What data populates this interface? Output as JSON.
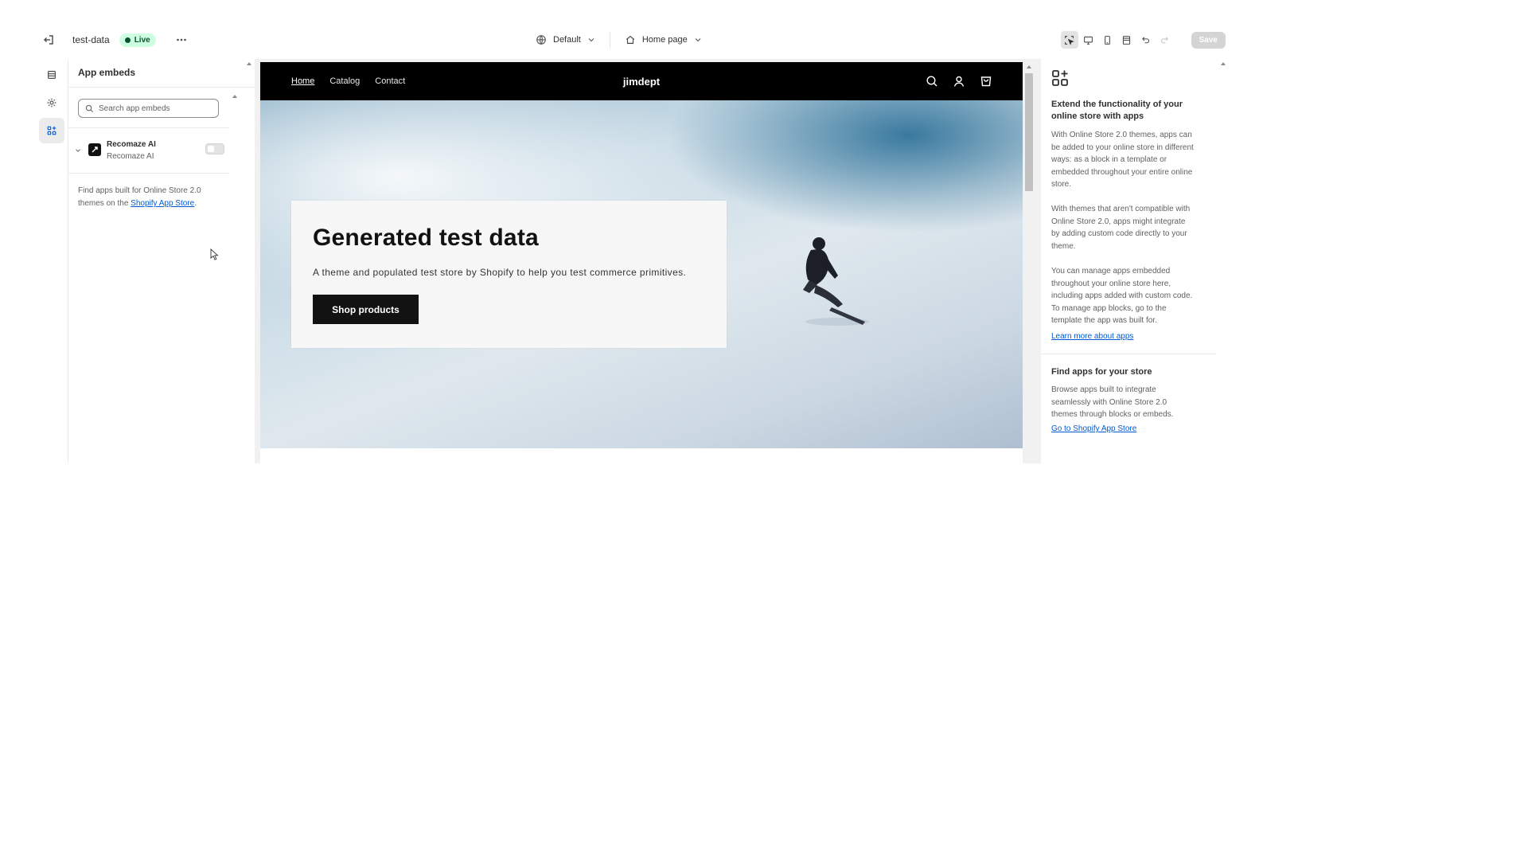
{
  "topbar": {
    "store_name": "test-data",
    "live_badge": "Live",
    "theme_dropdown": "Default",
    "page_dropdown": "Home page",
    "save_label": "Save"
  },
  "left_panel": {
    "title": "App embeds",
    "search_placeholder": "Search app embeds",
    "embeds": [
      {
        "name": "Recomaze AI",
        "sub": "Recomaze AI",
        "enabled": false
      }
    ],
    "footer_text": "Find apps built for Online Store 2.0 themes on the ",
    "footer_link": "Shopify App Store",
    "footer_end": "."
  },
  "preview": {
    "nav": [
      "Home",
      "Catalog",
      "Contact"
    ],
    "active_nav": "Home",
    "logo": "jimdept",
    "hero_title": "Generated test data",
    "hero_subtitle": "A theme and populated test store by Shopify to help you test commerce primitives.",
    "hero_button": "Shop products"
  },
  "right_panel": {
    "heading1": "Extend the functionality of your online store with apps",
    "para1": "With Online Store 2.0 themes, apps can be added to your online store in different ways: as a block in a template or embedded throughout your entire online store.",
    "para2": "With themes that aren't compatible with Online Store 2.0, apps might integrate by adding custom code directly to your theme.",
    "para3": "You can manage apps embedded throughout your online store here, including apps added with custom code. To manage app blocks, go to the template the app was built for.",
    "link1": "Learn more about apps",
    "heading2": "Find apps for your store",
    "para4": "Browse apps built to integrate seamlessly with Online Store 2.0 themes through blocks or embeds.",
    "link2": "Go to Shopify App Store"
  },
  "colors": {
    "live_bg": "#cdfee1",
    "live_fg": "#0c5132",
    "link": "#005bd3",
    "preview_header": "#000000"
  }
}
